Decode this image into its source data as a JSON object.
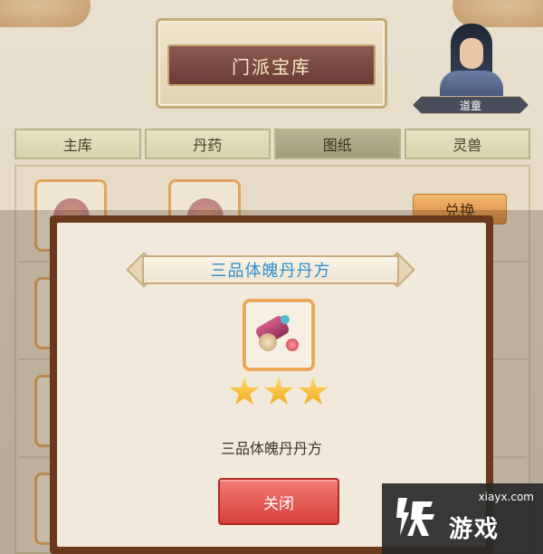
{
  "header": {
    "title": "门派宝库"
  },
  "character": {
    "name": "道童"
  },
  "tabs": [
    {
      "label": "主库",
      "active": false
    },
    {
      "label": "丹药",
      "active": false
    },
    {
      "label": "图纸",
      "active": true
    },
    {
      "label": "灵兽",
      "active": false
    }
  ],
  "list": {
    "exchange_label": "兑换"
  },
  "modal": {
    "title": "三品体魄丹丹方",
    "item_name": "三品体魄丹丹方",
    "stars": 3,
    "close_label": "关闭"
  },
  "watermark": {
    "url": "xiayx.com",
    "text": "游戏"
  },
  "colors": {
    "title_blue": "#2b8fd0",
    "close_red": "#d8403b",
    "slot_orange": "#e9a85a",
    "star_gold": "#f0a818"
  }
}
